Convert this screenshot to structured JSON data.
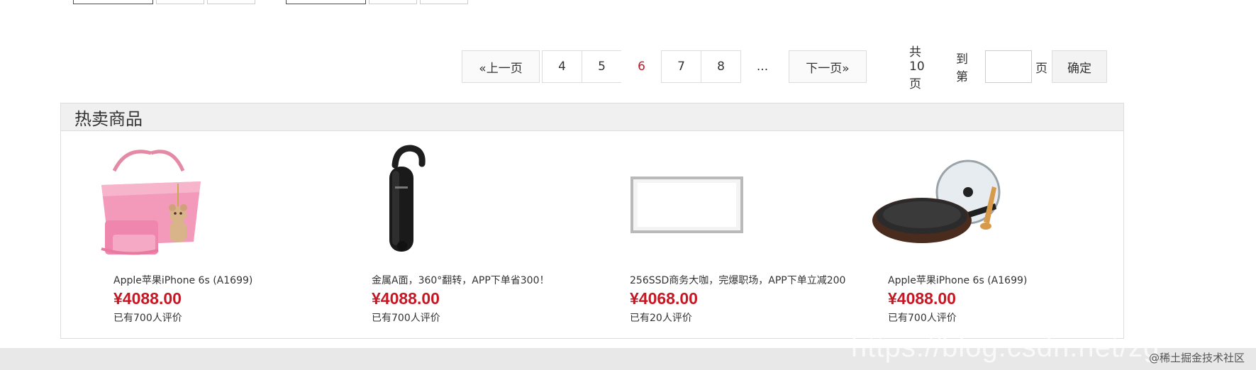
{
  "pagination": {
    "prev_label": "«上一页",
    "pages": [
      "4",
      "5",
      "6",
      "7",
      "8"
    ],
    "current_page": "6",
    "ellipsis": "...",
    "next_label": "下一页»",
    "total_label": "共10页",
    "goto_label": "到第",
    "page_unit": "页",
    "page_input_value": "",
    "confirm_label": "确定"
  },
  "hot_goods": {
    "title": "热卖商品",
    "items": [
      {
        "name": "Apple苹果iPhone 6s (A1699)",
        "price": "¥4088.00",
        "comments": "已有700人评价",
        "image": "pink-handbag-set"
      },
      {
        "name": "金属A面，360°翻转，APP下单省300！",
        "price": "¥4088.00",
        "comments": "已有700人评价",
        "image": "bluetooth-headset"
      },
      {
        "name": "256SSD商务大咖，完爆职场，APP下单立减200",
        "price": "¥4068.00",
        "comments": "已有20人评价",
        "image": "led-ceiling-panel"
      },
      {
        "name": "Apple苹果iPhone 6s (A1699)",
        "price": "¥4088.00",
        "comments": "已有700人评价",
        "image": "frying-pan-with-lid"
      }
    ]
  },
  "watermark": {
    "url": "https://blog.csdn.net/zg",
    "credit": "@稀土掘金技术社区"
  },
  "colors": {
    "accent_red": "#c81623",
    "panel_header_bg": "#f0f0f0",
    "border": "#dddddd"
  }
}
